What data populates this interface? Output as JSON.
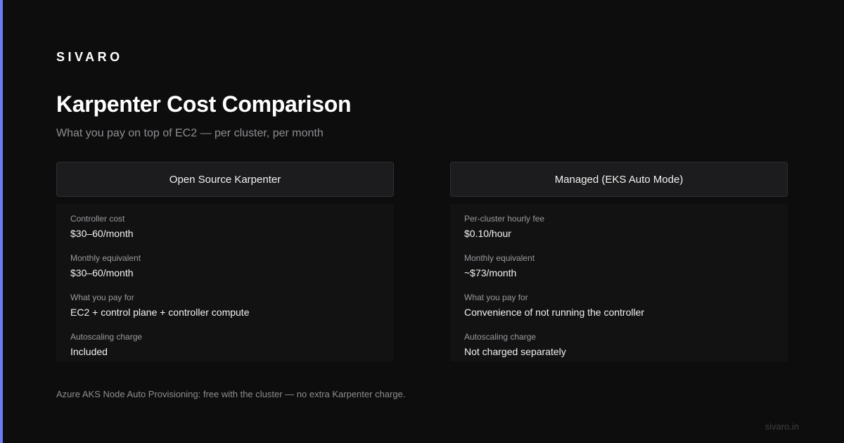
{
  "brand": "SIVARO",
  "title": "Karpenter Cost Comparison",
  "subtitle": "What you pay on top of EC2 — per cluster, per month",
  "columns": [
    {
      "header": "Open Source Karpenter",
      "rows": [
        {
          "label": "Controller cost",
          "value": "$30–60/month"
        },
        {
          "label": "Monthly equivalent",
          "value": "$30–60/month"
        },
        {
          "label": "What you pay for",
          "value": "EC2 + control plane + controller compute"
        },
        {
          "label": "Autoscaling charge",
          "value": "Included"
        }
      ]
    },
    {
      "header": "Managed (EKS Auto Mode)",
      "rows": [
        {
          "label": "Per-cluster hourly fee",
          "value": "$0.10/hour"
        },
        {
          "label": "Monthly equivalent",
          "value": "~$73/month"
        },
        {
          "label": "What you pay for",
          "value": "Convenience of not running the controller"
        },
        {
          "label": "Autoscaling charge",
          "value": "Not charged separately"
        }
      ]
    }
  ],
  "footnote": "Azure AKS Node Auto Provisioning: free with the cluster — no extra Karpenter charge.",
  "site": "sivaro.in",
  "colors": {
    "background": "#0d0d0d",
    "accent": "#6b7cf6",
    "header_bg": "#1c1c1e",
    "row_bg": "#121212",
    "muted_text": "#8e8e93"
  }
}
